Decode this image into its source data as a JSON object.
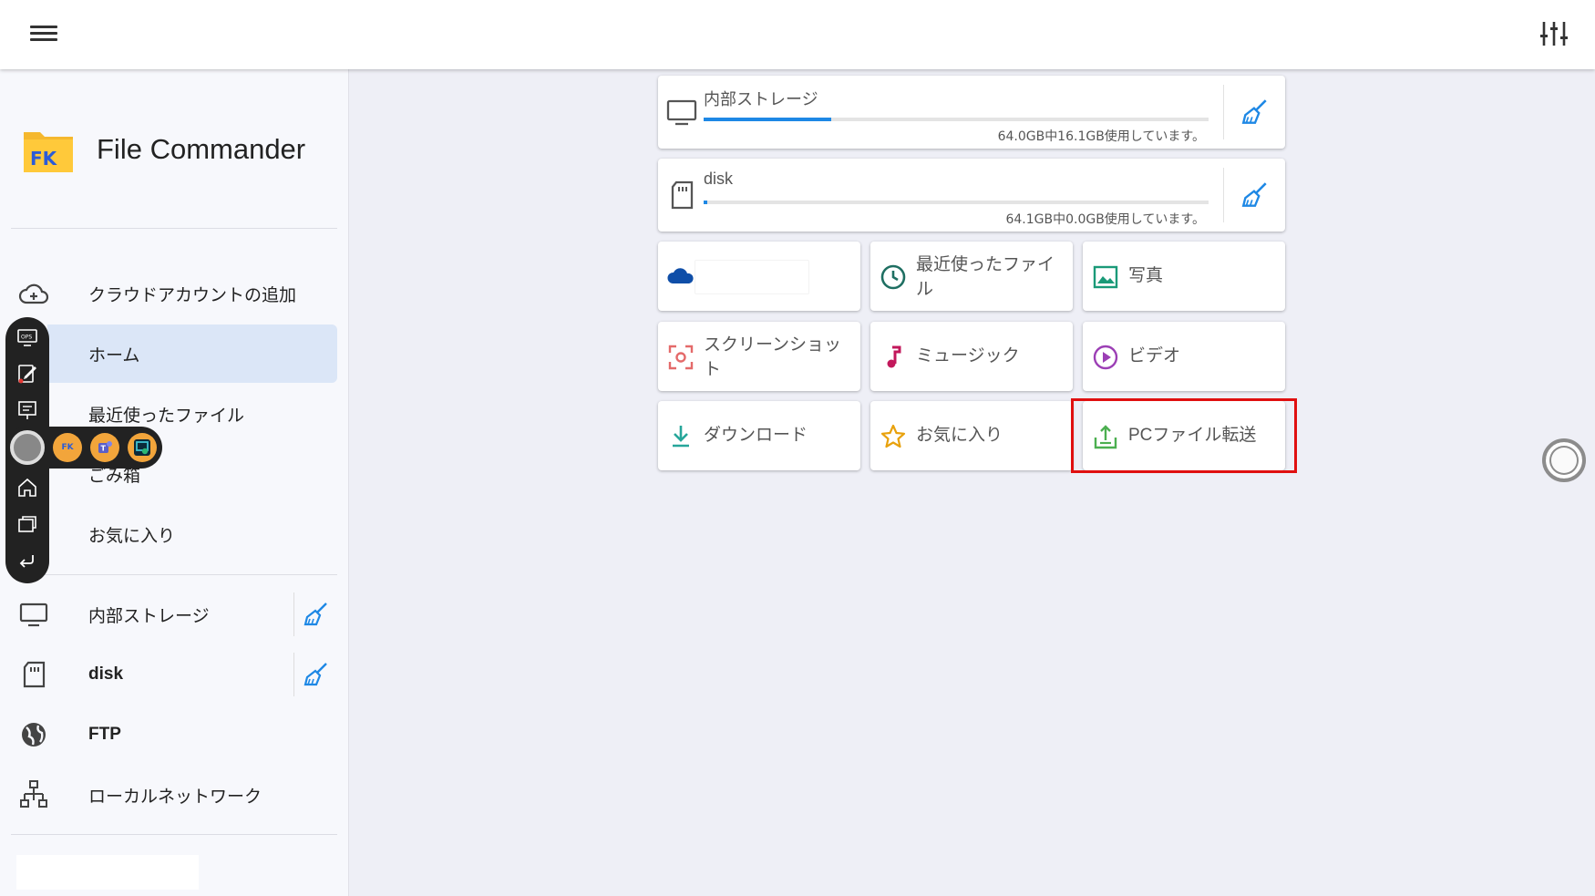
{
  "app": {
    "title": "File Commander"
  },
  "sidebar": {
    "items": [
      {
        "label": "クラウドアカウントの追加",
        "icon": "cloud-add-icon"
      },
      {
        "label": "ホーム",
        "icon": "home-icon",
        "active": true
      },
      {
        "label": "最近使ったファイル",
        "icon": "clock-icon"
      },
      {
        "label": "ごみ箱",
        "icon": "trash-icon"
      },
      {
        "label": "お気に入り",
        "icon": "star-icon"
      },
      {
        "label": "内部ストレージ",
        "icon": "monitor-icon"
      },
      {
        "label": "disk",
        "icon": "sd-card-icon"
      },
      {
        "label": "FTP",
        "icon": "globe-icon"
      },
      {
        "label": "ローカルネットワーク",
        "icon": "network-icon"
      }
    ]
  },
  "storage": [
    {
      "name": "内部ストレージ",
      "usage": "64.0GB中16.1GB使用しています。",
      "used_fraction": 0.252,
      "icon": "monitor-icon"
    },
    {
      "name": "disk",
      "usage": "64.1GB中0.0GB使用しています。",
      "used_fraction": 0.008,
      "icon": "sd-card-icon"
    }
  ],
  "tiles": [
    {
      "label": "",
      "icon": "onedrive-cloud-icon"
    },
    {
      "label": "最近使ったファイル",
      "icon": "clock-icon"
    },
    {
      "label": "写真",
      "icon": "image-icon"
    },
    {
      "label": "スクリーンショット",
      "icon": "screenshot-icon"
    },
    {
      "label": "ミュージック",
      "icon": "music-note-icon"
    },
    {
      "label": "ビデオ",
      "icon": "play-circle-icon"
    },
    {
      "label": "ダウンロード",
      "icon": "download-icon"
    },
    {
      "label": "お気に入り",
      "icon": "star-outline-icon"
    },
    {
      "label": "PCファイル転送",
      "icon": "pc-transfer-icon"
    }
  ],
  "floating_toolbar": {
    "ops_label": "OPS",
    "app_badge": "FK"
  },
  "colors": {
    "accent_blue": "#1e88e5",
    "highlight_red": "#e01010",
    "brand_yellow": "#f5b82e"
  }
}
